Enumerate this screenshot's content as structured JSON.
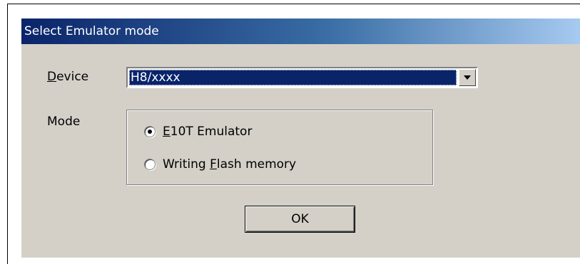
{
  "dialog": {
    "title": "Select Emulator mode",
    "device": {
      "label_underlined": "D",
      "label_rest": "evice",
      "value": "H8/xxxx"
    },
    "mode": {
      "label": "Mode",
      "options": [
        {
          "underlined": "E",
          "rest": "10T Emulator",
          "checked": true
        },
        {
          "prefix": "Writing ",
          "underlined": "F",
          "rest": "lash memory",
          "checked": false
        }
      ]
    },
    "ok_label": "OK"
  },
  "icons": [
    "dropdown-arrow-icon",
    "radio-checked-icon",
    "radio-unchecked-icon"
  ]
}
